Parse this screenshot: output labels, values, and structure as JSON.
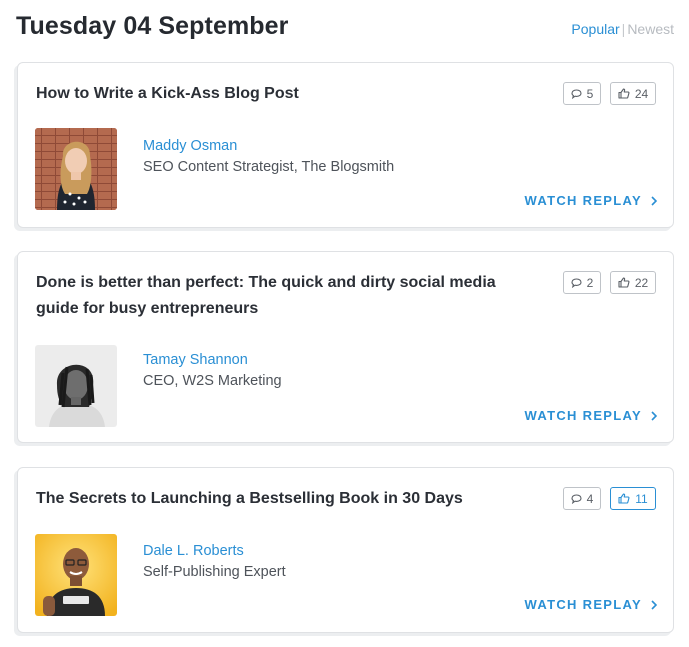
{
  "header": {
    "title": "Tuesday 04 September",
    "sort_popular": "Popular",
    "sort_separator": "|",
    "sort_newest": "Newest"
  },
  "colors": {
    "accent": "#2a8fd4",
    "text_dark": "#2b2f36",
    "muted": "#b7bbc0"
  },
  "sessions": [
    {
      "title": "How to Write a Kick-Ass Blog Post",
      "comments": "5",
      "likes": "24",
      "likes_active": false,
      "speaker_name": "Maddy Osman",
      "speaker_role": "SEO Content Strategist, The Blogsmith",
      "action": "WATCH REPLAY"
    },
    {
      "title": "Done is better than perfect: The quick and dirty social media guide for busy entrepreneurs",
      "comments": "2",
      "likes": "22",
      "likes_active": false,
      "speaker_name": "Tamay Shannon",
      "speaker_role": "CEO, W2S Marketing",
      "action": "WATCH REPLAY"
    },
    {
      "title": "The Secrets to Launching a Bestselling Book in 30 Days",
      "comments": "4",
      "likes": "11",
      "likes_active": true,
      "speaker_name": "Dale L. Roberts",
      "speaker_role": "Self-Publishing Expert",
      "action": "WATCH REPLAY"
    }
  ],
  "icons": {
    "comment": "comment-icon",
    "like": "thumbs-up-icon",
    "chevron": "chevron-right-icon"
  }
}
